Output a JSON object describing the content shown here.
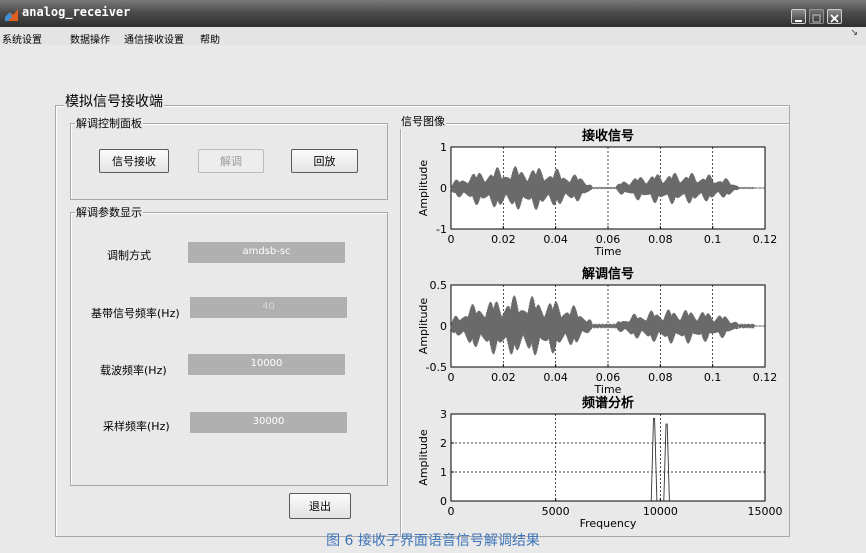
{
  "window": {
    "title": "analog_receiver"
  },
  "menu": {
    "items": [
      {
        "label": "系统设置"
      },
      {
        "label": "数据操作"
      },
      {
        "label": "通信接收设置"
      },
      {
        "label": "帮助"
      }
    ]
  },
  "main_panel": {
    "title": "模拟信号接收端"
  },
  "control_panel": {
    "title": "解调控制面板",
    "receive_label": "信号接收",
    "demod_label": "解调",
    "playback_label": "回放"
  },
  "params_panel": {
    "title": "解调参数显示",
    "rows": [
      {
        "label": "调制方式",
        "value": "amdsb-sc"
      },
      {
        "label": "基带信号频率(Hz)",
        "value": "40"
      },
      {
        "label": "载波频率(Hz)",
        "value": "10000"
      },
      {
        "label": "采样频率(Hz)",
        "value": "30000"
      }
    ]
  },
  "exit_label": "退出",
  "plots_panel": {
    "title": "信号图像"
  },
  "chart_data": [
    {
      "type": "line",
      "title": "接收信号",
      "xlabel": "Time",
      "ylabel": "Amplitude",
      "xlim": [
        0,
        0.12
      ],
      "ylim": [
        -1,
        1
      ],
      "xticks": [
        "0",
        "0.02",
        "0.04",
        "0.06",
        "0.08",
        "0.1",
        "0.12"
      ],
      "yticks": [
        "-1",
        "0",
        "1"
      ],
      "grid": true,
      "series": [
        {
          "segments": [
            {
              "start": 0.0,
              "end": 0.054,
              "amplitude": 0.55
            },
            {
              "start": 0.063,
              "end": 0.11,
              "amplitude": 0.4
            }
          ]
        }
      ]
    },
    {
      "type": "line",
      "title": "解调信号",
      "xlabel": "Time",
      "ylabel": "Amplitude",
      "xlim": [
        0,
        0.12
      ],
      "ylim": [
        -0.5,
        0.5
      ],
      "xticks": [
        "0",
        "0.02",
        "0.04",
        "0.06",
        "0.08",
        "0.1",
        "0.12"
      ],
      "yticks": [
        "-0.5",
        "0",
        "0.5"
      ],
      "grid": true,
      "series": [
        {
          "segments": [
            {
              "start": 0.0,
              "end": 0.054,
              "amplitude": 0.38
            },
            {
              "start": 0.063,
              "end": 0.11,
              "amplitude": 0.22
            }
          ]
        }
      ]
    },
    {
      "type": "line",
      "title": "频谱分析",
      "xlabel": "Frequency",
      "ylabel": "Amplitude",
      "xlim": [
        0,
        15000
      ],
      "ylim": [
        0,
        3
      ],
      "xticks": [
        "0",
        "5000",
        "10000",
        "15000"
      ],
      "yticks": [
        "0",
        "1",
        "2",
        "3"
      ],
      "grid": true,
      "series": [
        {
          "peaks": [
            {
              "x": 9700,
              "y": 2.85
            },
            {
              "x": 10300,
              "y": 2.65
            }
          ]
        }
      ]
    }
  ],
  "caption": "图 6 接收子界面语音信号解调结果"
}
